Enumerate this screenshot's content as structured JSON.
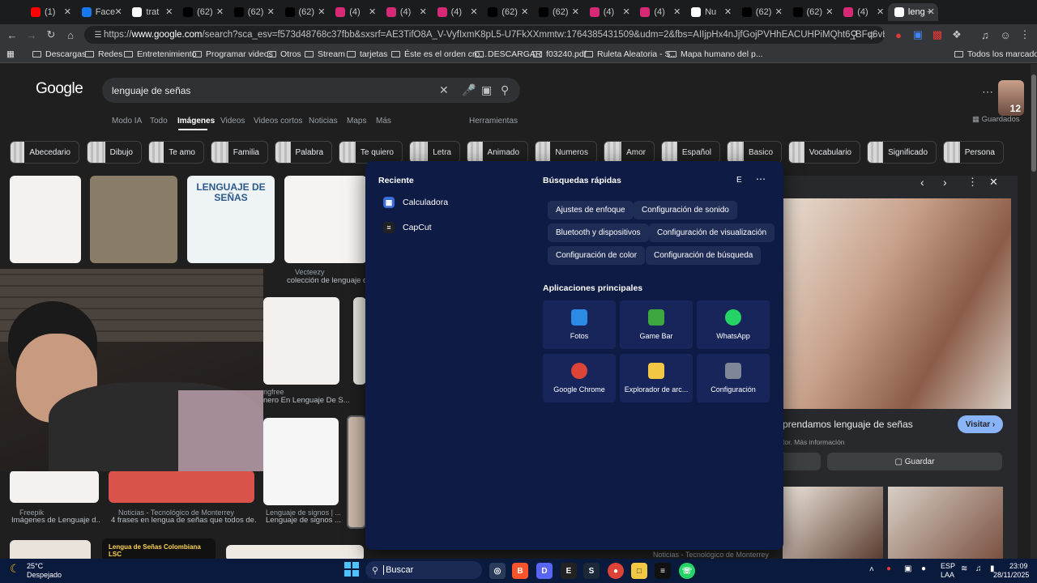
{
  "browser": {
    "tabs": [
      {
        "label": "(1)",
        "icon": "youtube-icon",
        "color": "#ff0000"
      },
      {
        "label": "Face",
        "icon": "facebook-icon",
        "color": "#1877f2"
      },
      {
        "label": "trat",
        "icon": "google-icon",
        "color": "#ffffff"
      },
      {
        "label": "(62)",
        "icon": "tiktok-icon",
        "color": "#000000"
      },
      {
        "label": "(62)",
        "icon": "tiktok-icon",
        "color": "#000000"
      },
      {
        "label": "(62)",
        "icon": "tiktok-icon",
        "color": "#000000"
      },
      {
        "label": "(4)",
        "icon": "instagram-icon",
        "color": "#d62976"
      },
      {
        "label": "(4)",
        "icon": "instagram-icon",
        "color": "#d62976"
      },
      {
        "label": "(4)",
        "icon": "instagram-icon",
        "color": "#d62976"
      },
      {
        "label": "(62)",
        "icon": "tiktok-icon",
        "color": "#000000"
      },
      {
        "label": "(62)",
        "icon": "tiktok-icon",
        "color": "#000000"
      },
      {
        "label": "(4)",
        "icon": "instagram-icon",
        "color": "#d62976"
      },
      {
        "label": "(4)",
        "icon": "instagram-icon",
        "color": "#d62976"
      },
      {
        "label": "Nu",
        "icon": "notion-icon",
        "color": "#ffffff"
      },
      {
        "label": "(62)",
        "icon": "tiktok-icon",
        "color": "#000000"
      },
      {
        "label": "(62)",
        "icon": "tiktok-icon",
        "color": "#000000"
      },
      {
        "label": "(4)",
        "icon": "instagram-icon",
        "color": "#d62976"
      },
      {
        "label": "leng",
        "icon": "google-icon",
        "color": "#ffffff",
        "active": true
      }
    ],
    "url_prefix": "https://",
    "url_host": "www.google.com",
    "url_rest": "/search?sca_esv=f573d48768c37fbb&sxsrf=AE3TifO8A_V-VyfIxmK8pL5-U7FkXXmmtw:1764385431509&udm=2&fbs=AIIjpHx4nJjfGojPVHhEACUHPiMQht6_BFq6vBIoFFRK7qchKBv8IM7dq8CEqHO..."
  },
  "bookmarks": [
    "Descargas",
    "Redes",
    "Entretenimiento",
    "Programar videos",
    "Otros",
    "Stream",
    "tarjetas",
    "Éste es el orden cro...",
    "DESCARGAR",
    "f03240.pdf",
    "Ruleta Aleatoria - S...",
    "Mapa humano del p...",
    "Todos los marcadores"
  ],
  "google": {
    "logo": "Google",
    "query": "lenguaje de señas",
    "nav": [
      "Modo IA",
      "Todo",
      "Imágenes",
      "Videos",
      "Videos cortos",
      "Noticias",
      "Maps",
      "Más",
      "Herramientas"
    ],
    "chips": [
      "Abecedario",
      "Dibujo",
      "Te amo",
      "Familia",
      "Palabra",
      "Te quiero",
      "Letra",
      "Animado",
      "Numeros",
      "Amor",
      "Español",
      "Basico",
      "Vocabulario",
      "Significado",
      "Persona"
    ],
    "saved_label": "Guardados",
    "avatar_badge": "12",
    "captions": {
      "vecteezy_src": "Vecteezy",
      "vecteezy_title": "colección de lenguaje d...",
      "ngfree_src": "ngfree",
      "ngfree_title": "nero En Lenguaje De S...",
      "freepik_src": "Freepik",
      "freepik_title": "Imágenes de Lenguaje d...",
      "tec_src": "Noticias - Tecnológico de Monterrey",
      "tec_title": "4 frases en lengua de señas que todos de...",
      "signos_src": "Lenguaje de signos | ...",
      "signos_title": "Lenguaje de signos ...",
      "tec2_src": "Noticias - Tecnológico de Monterrey",
      "lsc_title": "Lengua de Señas Colombiana LSC",
      "card_lenguaje_title": "LENGUAJE DE SEÑAS"
    },
    "preview": {
      "title": "prendamos lenguaje de señas",
      "visit": "Visitar",
      "info": "tor. Más información",
      "save": "Guardar"
    }
  },
  "start_menu": {
    "recent_title": "Reciente",
    "recent": [
      {
        "label": "Calculadora",
        "icon": "calculator-icon"
      },
      {
        "label": "CapCut",
        "icon": "capcut-icon"
      }
    ],
    "quick_title": "Búsquedas rápidas",
    "quick_badge": "E",
    "quick": [
      "Ajustes de enfoque",
      "Configuración de sonido",
      "Bluetooth y dispositivos",
      "Configuración de visualización",
      "Configuración de color",
      "Configuración de búsqueda"
    ],
    "apps_title": "Aplicaciones principales",
    "apps": [
      {
        "label": "Fotos",
        "icon": "photos-icon",
        "color": "#2b8ae6"
      },
      {
        "label": "Game Bar",
        "icon": "gamebar-icon",
        "color": "#3ea83e"
      },
      {
        "label": "WhatsApp",
        "icon": "whatsapp-icon",
        "color": "#25d366"
      },
      {
        "label": "Google Chrome",
        "icon": "chrome-icon",
        "color": "#db4437"
      },
      {
        "label": "Explorador de arc...",
        "icon": "folder-icon",
        "color": "#f2c744"
      },
      {
        "label": "Configuración",
        "icon": "settings-icon",
        "color": "#7d8796"
      }
    ]
  },
  "taskbar": {
    "search_placeholder": "Buscar",
    "weather_temp": "25°C",
    "weather_desc": "Despejado",
    "lang": "ESP",
    "lang2": "LAA",
    "time": "23:09",
    "date": "28/11/2025"
  }
}
